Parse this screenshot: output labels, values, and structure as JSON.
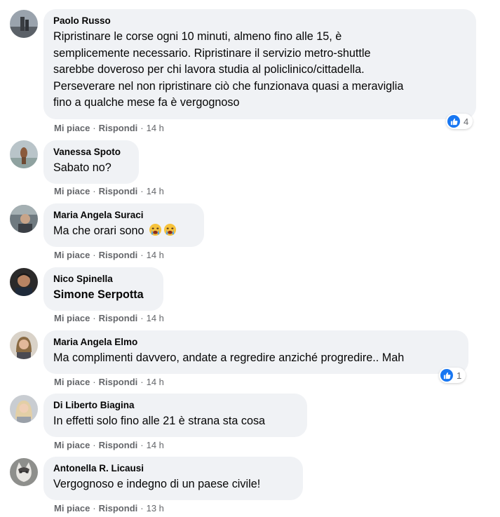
{
  "comments": [
    {
      "author": "Paolo Russo",
      "lines": [
        "Ripristinare le corse ogni 10 minuti, almeno fino alle 15, è",
        "semplicemente necessario. Ripristinare il servizio metro-shuttle",
        "sarebbe doveroso per chi lavora studia al policlinico/cittadella.",
        "Perseverare nel non ripristinare ciò che funzionava quasi a meraviglia",
        "fino a qualche mese fa è vergognoso"
      ],
      "like": "Mi piace",
      "reply": "Rispondi",
      "time": "14 h",
      "reaction_count": "4"
    },
    {
      "author": "Vanessa Spoto",
      "text": "Sabato no?",
      "like": "Mi piace",
      "reply": "Rispondi",
      "time": "14 h"
    },
    {
      "author": "Maria Angela Suraci",
      "text": "Ma che orari sono",
      "like": "Mi piace",
      "reply": "Rispondi",
      "time": "14 h",
      "emoji": "crying-face-icon"
    },
    {
      "author": "Nico Spinella",
      "text": "Simone Serpotta",
      "like": "Mi piace",
      "reply": "Rispondi",
      "time": "14 h"
    },
    {
      "author": "Maria Angela Elmo",
      "text": "Ma complimenti davvero, andate a regredire anziché progredire.. Mah",
      "like": "Mi piace",
      "reply": "Rispondi",
      "time": "14 h",
      "reaction_count": "1"
    },
    {
      "author": "Di Liberto Biagina",
      "text": "In effetti solo fino alle 21 è strana sta cosa",
      "like": "Mi piace",
      "reply": "Rispondi",
      "time": "14 h"
    },
    {
      "author": "Antonella R. Licausi",
      "text": "Vergognoso e indegno di un paese civile!",
      "like": "Mi piace",
      "reply": "Rispondi",
      "time": "13 h"
    }
  ],
  "separator": "·",
  "colors": {
    "bubble": "#f0f2f5",
    "secondary_text": "#65676b",
    "like_blue": "#1877f2"
  }
}
